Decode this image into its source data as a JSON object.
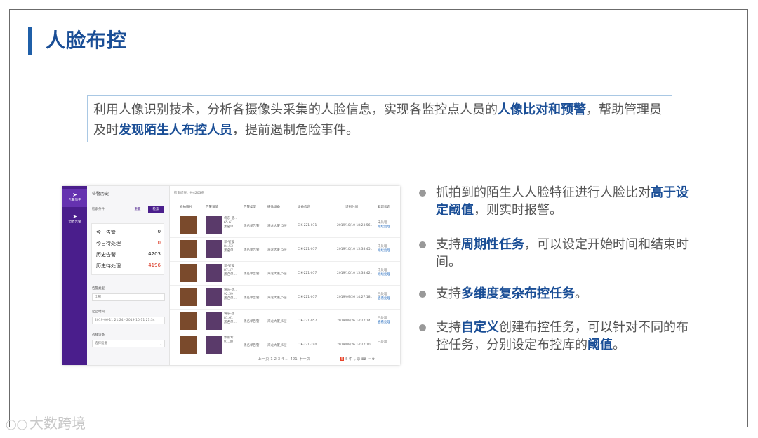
{
  "title": "人脸布控",
  "intro": {
    "p1": "利用人像识别技术，分析各摄像头采集的人脸信息，实现各监控点人员的",
    "b1": "人像比对和预警",
    "p2": "，帮助管理员及时",
    "b2": "发现陌生人布控人员",
    "p3": "，提前遏制危险事件。"
  },
  "screenshot": {
    "sidebar": [
      {
        "icon": "pin-icon",
        "label": "告警历史"
      },
      {
        "icon": "pin-icon",
        "label": "边界告警"
      }
    ],
    "panel": {
      "title": "告警历史",
      "filter_label": "检索条件",
      "reset_label": "重置",
      "search_label": "检索",
      "stats": [
        {
          "label": "今日告警",
          "value": "0",
          "highlight": false
        },
        {
          "label": "今日待处理",
          "value": "0",
          "highlight": true
        },
        {
          "label": "历史告警",
          "value": "4203",
          "highlight": false
        },
        {
          "label": "历史待处理",
          "value": "4196",
          "highlight": true
        }
      ],
      "alarm_type_label": "告警类型",
      "alarm_type_value": "全部",
      "time_label": "起止时间",
      "time_value": "2019-06-11 21:24 - 2019-10-11 21:34",
      "device_label": "选择设备",
      "device_placeholder": "选择设备"
    },
    "results_label": "检索结果：共4203条",
    "columns": [
      "抓拍照片",
      "告警详情",
      "告警类型",
      "摄像设备",
      "设备信息",
      "识别时间",
      "处理状态"
    ],
    "rows": [
      {
        "detail": [
          "将东-选..",
          "65.61",
          "黑名单..."
        ],
        "type": "黑名单告警",
        "camera": "海龙大厦_5层",
        "device": "CIK-221-071",
        "time": "2019/10/10 18:23:56..",
        "status": "未处理",
        "action": "继续处理"
      },
      {
        "detail": [
          "郭-崔俊",
          "84.53",
          "黑名单..."
        ],
        "type": "黑名单告警",
        "camera": "海龙大厦_5层",
        "device": "CIK-221-057",
        "time": "2019/10/10 15:38:45..",
        "status": "未处理",
        "action": "继续处理"
      },
      {
        "detail": [
          "郭-崔俊",
          "87.47",
          "黑名单..."
        ],
        "type": "黑名单告警",
        "camera": "海龙大厦_5层",
        "device": "CIK-221-057",
        "time": "2019/10/10 15:38:42..",
        "status": "未处理",
        "action": "继续处理"
      },
      {
        "detail": [
          "将东-选..",
          "92.59",
          "黑名单..."
        ],
        "type": "黑名单告警",
        "camera": "海龙大厦_5层",
        "device": "CIK-221-057",
        "time": "2019/09/26 14:27:18..",
        "status": "已处理",
        "action": "查看处理"
      },
      {
        "detail": [
          "将东-选..",
          "81.61",
          "黑名单..."
        ],
        "type": "黑名单告警",
        "camera": "海龙大厦_5层",
        "device": "CIK-221-057",
        "time": "2019/09/26 14:27:14..",
        "status": "已处理",
        "action": "查看处理"
      },
      {
        "detail": [
          "郭雨专",
          "91.30",
          ""
        ],
        "type": "黑名单告警",
        "camera": "海龙大厦_5层",
        "device": "CIK-221-240",
        "time": "2019/09/26 14:27:10..",
        "status": "已处理",
        "action": ""
      }
    ],
    "pager": "上一页  1  2  3  4  ...  421  下一页",
    "tray": "S 中 ·,  ☺  ⌨  ✂  ⚙"
  },
  "bullets": [
    {
      "parts": [
        {
          "t": "抓拍到的陌生人人脸特征进行人脸比对",
          "b": false
        },
        {
          "t": "高于设定阈值",
          "b": true
        },
        {
          "t": "，则实时报警。",
          "b": false
        }
      ]
    },
    {
      "parts": [
        {
          "t": "支持",
          "b": false
        },
        {
          "t": "周期性任务",
          "b": true
        },
        {
          "t": "，可以设定开始时间和结束时间。",
          "b": false
        }
      ]
    },
    {
      "parts": [
        {
          "t": "支持",
          "b": false
        },
        {
          "t": "多维度复杂布控任务",
          "b": true
        },
        {
          "t": "。",
          "b": false
        }
      ]
    },
    {
      "parts": [
        {
          "t": "支持",
          "b": false
        },
        {
          "t": "自定义",
          "b": true
        },
        {
          "t": "创建布控任务，可以针对不同的布控任务，分别设定布控库的",
          "b": false
        },
        {
          "t": "阈值",
          "b": true
        },
        {
          "t": "。",
          "b": false
        }
      ]
    }
  ],
  "watermark": "大数跨境",
  "colors": {
    "title": "#1a4e96",
    "sidebar": "#4a1e8c",
    "accent_red": "#d9301b"
  }
}
